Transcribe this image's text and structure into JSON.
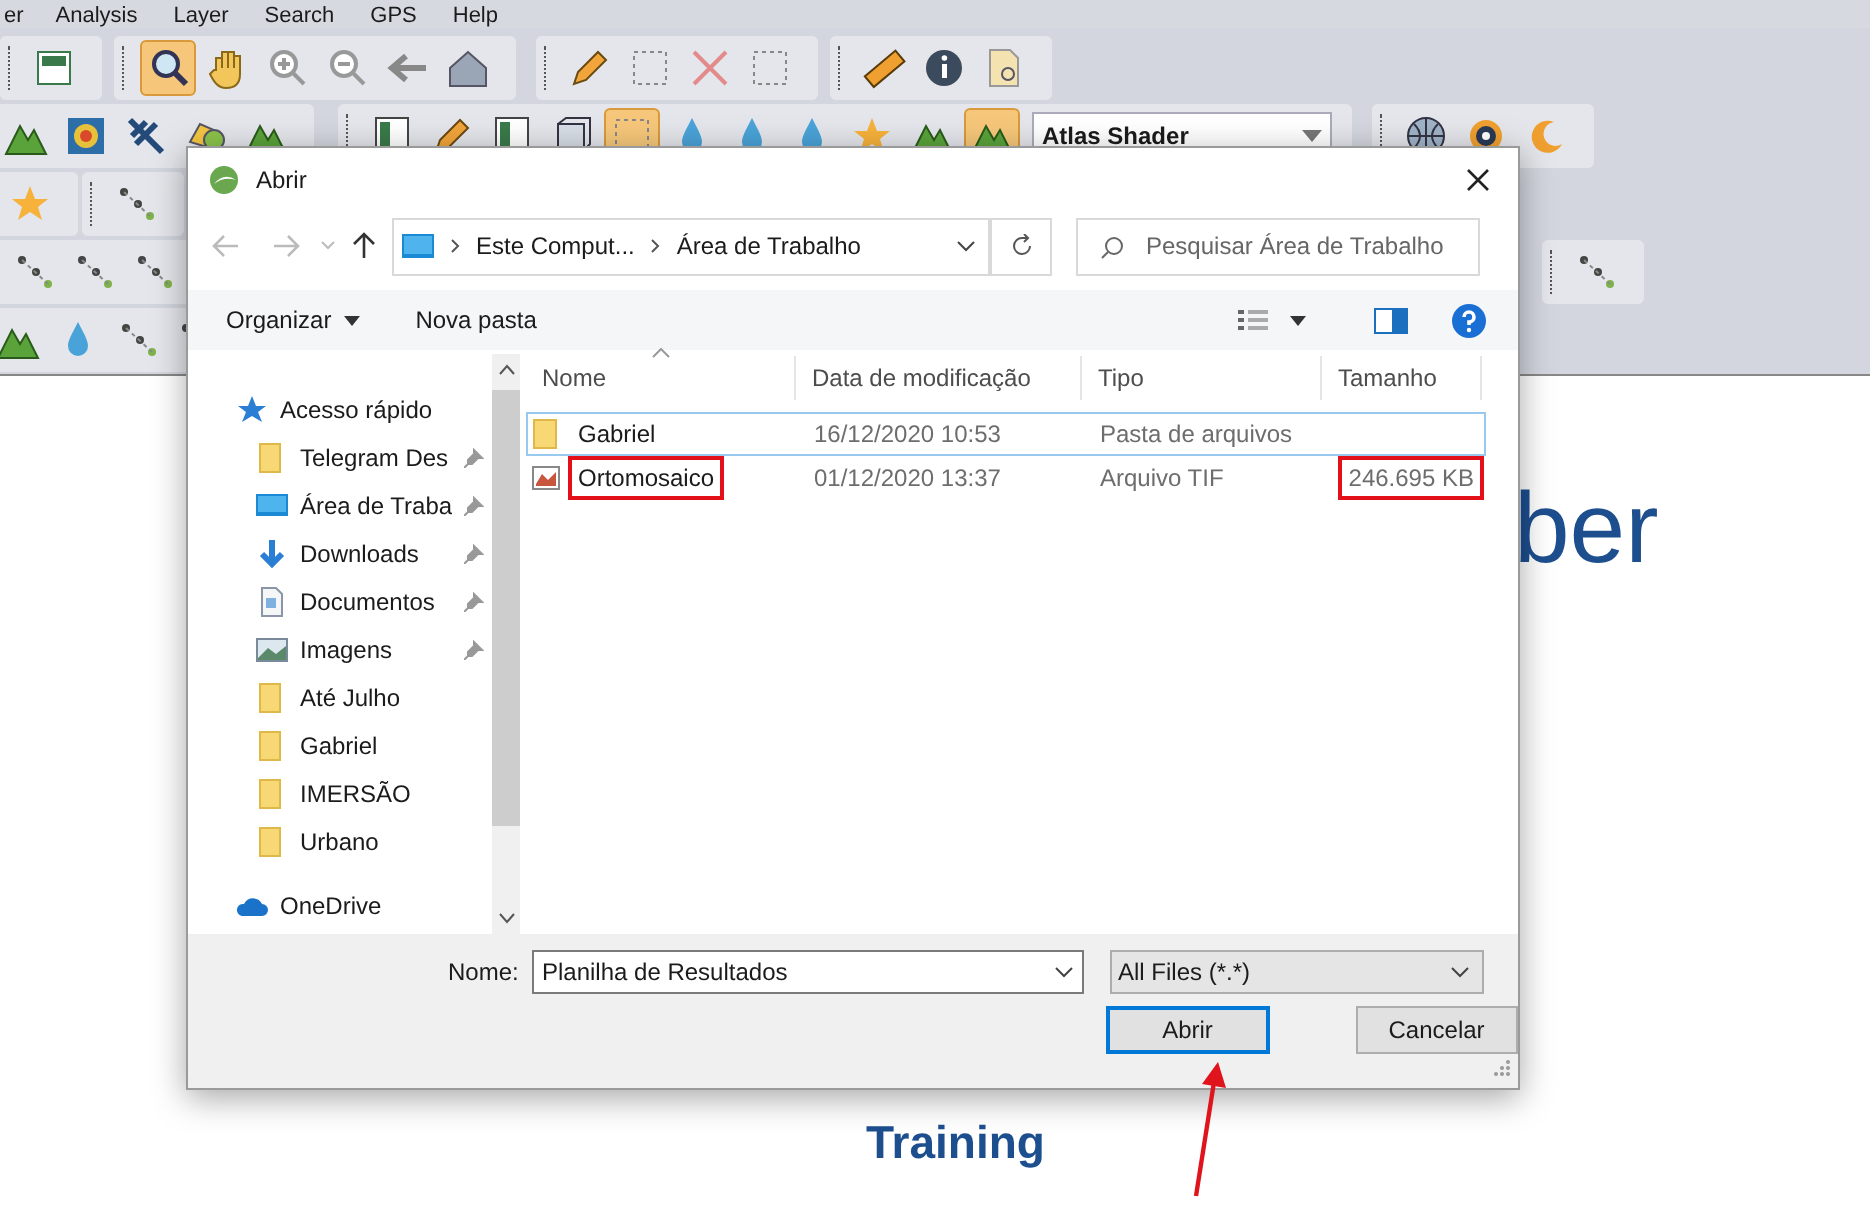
{
  "app": {
    "menu": [
      "er",
      "Analysis",
      "Layer",
      "Search",
      "GPS",
      "Help"
    ],
    "shader_select": "Atlas Shader",
    "canvas": {
      "logo_text": "ber",
      "caption": "Training"
    }
  },
  "dialog": {
    "title": "Abrir",
    "breadcrumb": [
      "Este Comput...",
      "Área de Trabalho"
    ],
    "search_placeholder": "Pesquisar Área de Trabalho",
    "commands": [
      "Organizar",
      "Nova pasta"
    ],
    "nav": [
      {
        "label": "Acesso rápido",
        "kind": "quick",
        "children": [
          {
            "label": "Telegram Des",
            "kind": "folder",
            "pinned": true
          },
          {
            "label": "Área de Traba",
            "kind": "desktop",
            "pinned": true
          },
          {
            "label": "Downloads",
            "kind": "downloads",
            "pinned": true
          },
          {
            "label": "Documentos",
            "kind": "documents",
            "pinned": true
          },
          {
            "label": "Imagens",
            "kind": "pictures",
            "pinned": true
          },
          {
            "label": "Até Julho",
            "kind": "folder",
            "pinned": false
          },
          {
            "label": "Gabriel",
            "kind": "folder",
            "pinned": false
          },
          {
            "label": "IMERSÃO",
            "kind": "folder",
            "pinned": false
          },
          {
            "label": "Urbano",
            "kind": "folder",
            "pinned": false
          }
        ]
      },
      {
        "label": "OneDrive",
        "kind": "cloud"
      }
    ],
    "columns": [
      "Nome",
      "Data de modificação",
      "Tipo",
      "Tamanho"
    ],
    "files": [
      {
        "name": "Gabriel",
        "modified": "16/12/2020 10:53",
        "type": "Pasta de arquivos",
        "kind": "folder",
        "focused": true,
        "marked": false
      },
      {
        "name": "Ortomosaico",
        "modified": "01/12/2020 13:37",
        "type": "Arquivo TIF",
        "size": "246.695 KB",
        "kind": "image",
        "focused": false,
        "marked": true
      }
    ],
    "filename_label": "Nome:",
    "filename": "Planilha de Resultados",
    "filetype": "All Files (*.*)",
    "buttons": [
      {
        "label": "Abrir",
        "default": true
      },
      {
        "label": "Cancelar",
        "default": false
      }
    ]
  }
}
